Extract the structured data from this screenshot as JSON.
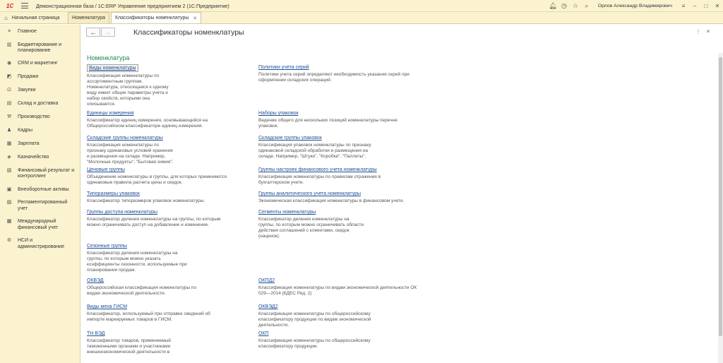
{
  "titlebar": {
    "logo": "1С",
    "title": "Демонстрационная база / 1С:ERP Управление предприятием 2  (1С:Предприятие)",
    "user": "Орлов Александр Владимирович"
  },
  "tabs": {
    "home": "Начальная страница",
    "items": [
      {
        "label": "Номенклатура"
      },
      {
        "label": "Классификаторы номенклатуры"
      }
    ]
  },
  "sidebar": {
    "items": [
      {
        "icon": "≡",
        "label": "Главное"
      },
      {
        "icon": "▥",
        "label": "Бюджетирование и планирование"
      },
      {
        "icon": "◉",
        "label": "CRM и маркетинг"
      },
      {
        "icon": "◩",
        "label": "Продажи"
      },
      {
        "icon": "⊡",
        "label": "Закупки"
      },
      {
        "icon": "▤",
        "label": "Склад и доставка"
      },
      {
        "icon": "⚒",
        "label": "Производство"
      },
      {
        "icon": "♟",
        "label": "Кадры"
      },
      {
        "icon": "▦",
        "label": "Зарплата"
      },
      {
        "icon": "◈",
        "label": "Казначейство"
      },
      {
        "icon": "▧",
        "label": "Финансовый результат и контроллинг"
      },
      {
        "icon": "▣",
        "label": "Внеоборотные активы"
      },
      {
        "icon": "▨",
        "label": "Регламентированный учет"
      },
      {
        "icon": "▩",
        "label": "Международный финансовый учет"
      },
      {
        "icon": "⚙",
        "label": "НСИ и администрирование"
      }
    ]
  },
  "main": {
    "back": "←",
    "forward": "→",
    "title": "Классификаторы номенклатуры",
    "more": "⋮",
    "close": "×",
    "section": "Номенклатура",
    "left": [
      {
        "link": "Виды номенклатуры",
        "desc": "Классификация номенклатуры по ассортиментным группам. Номенклатура, относящаяся к одному виду имеет общие параметры учета и набор свойств, которыми она описывается."
      },
      {
        "link": "Единицы измерения",
        "desc": "Классификатор единиц измерения, основывающийся на Общероссийском классификаторе единиц измерения."
      },
      {
        "link": "Складские группы номенклатуры",
        "desc": "Классификация номенклатуры по признаку одинаковых условий хранения и размещения на складе. Например, \"Молочные продукты\", \"Бытовая химия\"."
      },
      {
        "link": "Ценовые группы",
        "desc": "Объединение номенклатуры в группы, для которых применяются одинаковые правила расчета цены и скидок."
      },
      {
        "link": "Типоразмеры упаковок",
        "desc": "Классификатор типоразмеров упаковок номенклатуры."
      },
      {
        "link": "Группы доступа номенклатуры",
        "desc": "Классификатор деления номенклатуры на группы, по которым можно ограничивать доступ на добавление и изменение."
      },
      {
        "link": "Сезонные группы",
        "desc": "Классификатор деления номенклатуры на группы, по которым можно указать коэффициенты сезонности, используемые при планировании продаж."
      },
      {
        "link": "ОКВЭД",
        "desc": "Общероссийская классификация номенклатуры по видам экономической деятельности."
      },
      {
        "link": "Виды меха ГИСМ",
        "desc": "Классификатор, используемый при отправке сведений об импорте маркируемых товаров в ГИСМ."
      },
      {
        "link": "ТН ВЭД",
        "desc": "Классификатор товаров, применяемый таможенными органами и участниками внешнеэкономической деятельности в"
      }
    ],
    "right": [
      {
        "link": "Политики учета серий",
        "desc": "Политики учета серий определяют необходимость указания серий при оформлении складских операций."
      },
      {
        "link": "Наборы упаковок",
        "desc": "Ведение общего для нескольких позиций номенклатуры перечня упаковок."
      },
      {
        "link": "Складские группы упаковок",
        "desc": "Классификация упаковок номенклатуры по признаку одинаковой складской обработки и размещения на складе. Например, \"Штуки\", \"Коробки\", \"Паллеты\"."
      },
      {
        "link": "Группы настроек финансового учета номенклатуры",
        "desc": "Классификация номенклатуры по правилам отражения в бухгалтерском учете."
      },
      {
        "link": "Группы аналитического учета номенклатуры",
        "desc": "Экономическая классификация номенклатуры в финансовом учете."
      },
      {
        "link": "Сегменты номенклатуры",
        "desc": "Классификатор деления номенклатуры на группы, по которым можно ограничивать области действия соглашений с клиентами, скидок (наценок)."
      },
      {
        "link": "ОКПД2",
        "desc": "Классификация номенклатуры по  видам экономической деятельности ОК 029—2014 (КДЕС Ред. 2)"
      },
      {
        "link": "ОКВЭД2",
        "desc": "Классификация номенклатуры по общероссийскому классификатору продукции по видам экономической деятельности."
      },
      {
        "link": "ОКП",
        "desc": "Классификация номенклатуры по общероссийскому классификатору продукции."
      }
    ]
  }
}
